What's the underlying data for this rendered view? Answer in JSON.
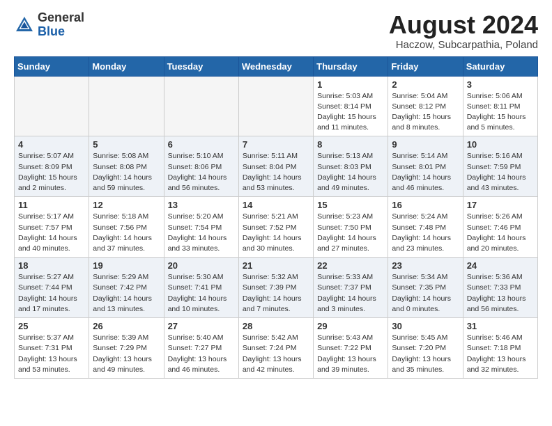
{
  "header": {
    "logo_general": "General",
    "logo_blue": "Blue",
    "month_year": "August 2024",
    "location": "Haczow, Subcarpathia, Poland"
  },
  "weekdays": [
    "Sunday",
    "Monday",
    "Tuesday",
    "Wednesday",
    "Thursday",
    "Friday",
    "Saturday"
  ],
  "weeks": [
    [
      {
        "day": "",
        "info": ""
      },
      {
        "day": "",
        "info": ""
      },
      {
        "day": "",
        "info": ""
      },
      {
        "day": "",
        "info": ""
      },
      {
        "day": "1",
        "info": "Sunrise: 5:03 AM\nSunset: 8:14 PM\nDaylight: 15 hours\nand 11 minutes."
      },
      {
        "day": "2",
        "info": "Sunrise: 5:04 AM\nSunset: 8:12 PM\nDaylight: 15 hours\nand 8 minutes."
      },
      {
        "day": "3",
        "info": "Sunrise: 5:06 AM\nSunset: 8:11 PM\nDaylight: 15 hours\nand 5 minutes."
      }
    ],
    [
      {
        "day": "4",
        "info": "Sunrise: 5:07 AM\nSunset: 8:09 PM\nDaylight: 15 hours\nand 2 minutes."
      },
      {
        "day": "5",
        "info": "Sunrise: 5:08 AM\nSunset: 8:08 PM\nDaylight: 14 hours\nand 59 minutes."
      },
      {
        "day": "6",
        "info": "Sunrise: 5:10 AM\nSunset: 8:06 PM\nDaylight: 14 hours\nand 56 minutes."
      },
      {
        "day": "7",
        "info": "Sunrise: 5:11 AM\nSunset: 8:04 PM\nDaylight: 14 hours\nand 53 minutes."
      },
      {
        "day": "8",
        "info": "Sunrise: 5:13 AM\nSunset: 8:03 PM\nDaylight: 14 hours\nand 49 minutes."
      },
      {
        "day": "9",
        "info": "Sunrise: 5:14 AM\nSunset: 8:01 PM\nDaylight: 14 hours\nand 46 minutes."
      },
      {
        "day": "10",
        "info": "Sunrise: 5:16 AM\nSunset: 7:59 PM\nDaylight: 14 hours\nand 43 minutes."
      }
    ],
    [
      {
        "day": "11",
        "info": "Sunrise: 5:17 AM\nSunset: 7:57 PM\nDaylight: 14 hours\nand 40 minutes."
      },
      {
        "day": "12",
        "info": "Sunrise: 5:18 AM\nSunset: 7:56 PM\nDaylight: 14 hours\nand 37 minutes."
      },
      {
        "day": "13",
        "info": "Sunrise: 5:20 AM\nSunset: 7:54 PM\nDaylight: 14 hours\nand 33 minutes."
      },
      {
        "day": "14",
        "info": "Sunrise: 5:21 AM\nSunset: 7:52 PM\nDaylight: 14 hours\nand 30 minutes."
      },
      {
        "day": "15",
        "info": "Sunrise: 5:23 AM\nSunset: 7:50 PM\nDaylight: 14 hours\nand 27 minutes."
      },
      {
        "day": "16",
        "info": "Sunrise: 5:24 AM\nSunset: 7:48 PM\nDaylight: 14 hours\nand 23 minutes."
      },
      {
        "day": "17",
        "info": "Sunrise: 5:26 AM\nSunset: 7:46 PM\nDaylight: 14 hours\nand 20 minutes."
      }
    ],
    [
      {
        "day": "18",
        "info": "Sunrise: 5:27 AM\nSunset: 7:44 PM\nDaylight: 14 hours\nand 17 minutes."
      },
      {
        "day": "19",
        "info": "Sunrise: 5:29 AM\nSunset: 7:42 PM\nDaylight: 14 hours\nand 13 minutes."
      },
      {
        "day": "20",
        "info": "Sunrise: 5:30 AM\nSunset: 7:41 PM\nDaylight: 14 hours\nand 10 minutes."
      },
      {
        "day": "21",
        "info": "Sunrise: 5:32 AM\nSunset: 7:39 PM\nDaylight: 14 hours\nand 7 minutes."
      },
      {
        "day": "22",
        "info": "Sunrise: 5:33 AM\nSunset: 7:37 PM\nDaylight: 14 hours\nand 3 minutes."
      },
      {
        "day": "23",
        "info": "Sunrise: 5:34 AM\nSunset: 7:35 PM\nDaylight: 14 hours\nand 0 minutes."
      },
      {
        "day": "24",
        "info": "Sunrise: 5:36 AM\nSunset: 7:33 PM\nDaylight: 13 hours\nand 56 minutes."
      }
    ],
    [
      {
        "day": "25",
        "info": "Sunrise: 5:37 AM\nSunset: 7:31 PM\nDaylight: 13 hours\nand 53 minutes."
      },
      {
        "day": "26",
        "info": "Sunrise: 5:39 AM\nSunset: 7:29 PM\nDaylight: 13 hours\nand 49 minutes."
      },
      {
        "day": "27",
        "info": "Sunrise: 5:40 AM\nSunset: 7:27 PM\nDaylight: 13 hours\nand 46 minutes."
      },
      {
        "day": "28",
        "info": "Sunrise: 5:42 AM\nSunset: 7:24 PM\nDaylight: 13 hours\nand 42 minutes."
      },
      {
        "day": "29",
        "info": "Sunrise: 5:43 AM\nSunset: 7:22 PM\nDaylight: 13 hours\nand 39 minutes."
      },
      {
        "day": "30",
        "info": "Sunrise: 5:45 AM\nSunset: 7:20 PM\nDaylight: 13 hours\nand 35 minutes."
      },
      {
        "day": "31",
        "info": "Sunrise: 5:46 AM\nSunset: 7:18 PM\nDaylight: 13 hours\nand 32 minutes."
      }
    ]
  ]
}
